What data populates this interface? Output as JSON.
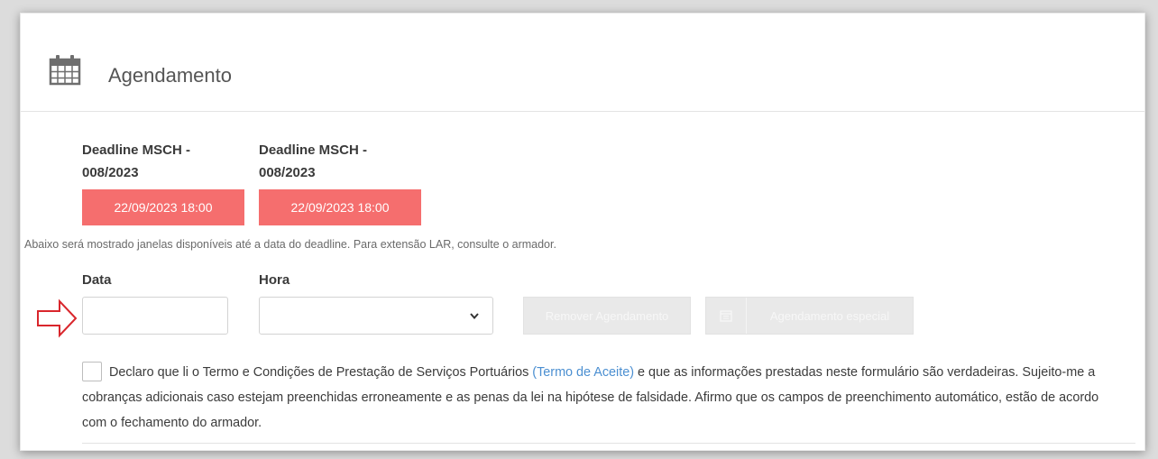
{
  "header": {
    "title": "Agendamento",
    "icon": "calendar-icon"
  },
  "deadlines": [
    {
      "label_line1": "Deadline MSCH -",
      "label_line2": "008/2023",
      "date": "22/09/2023 18:00"
    },
    {
      "label_line1": "Deadline MSCH -",
      "label_line2": "008/2023",
      "date": "22/09/2023 18:00"
    }
  ],
  "note": "Abaixo será mostrado janelas disponíveis até a data do deadline. Para extensão LAR, consulte o armador.",
  "form": {
    "data_label": "Data",
    "data_value": "",
    "hora_label": "Hora",
    "hora_value": "",
    "remove_button": "Remover Agendamento",
    "special_button": "Agendamento especial"
  },
  "declaration": {
    "before_link": "Declaro que li o Termo e Condições de Prestação de Serviços Portuários ",
    "link_text": "(Termo de Aceite)",
    "after_link": " e que as informações prestadas neste formulário são verdadeiras. Sujeito-me a cobranças adicionais caso estejam preenchidas erroneamente e as penas da lei na hipótese de falsidade. Afirmo que os campos de preenchimento automático, estão de acordo com o fechamento do armador.",
    "checked": false
  },
  "colors": {
    "deadline_badge": "#f56e6e",
    "link": "#4b8fd1",
    "arrow": "#d9262c"
  }
}
